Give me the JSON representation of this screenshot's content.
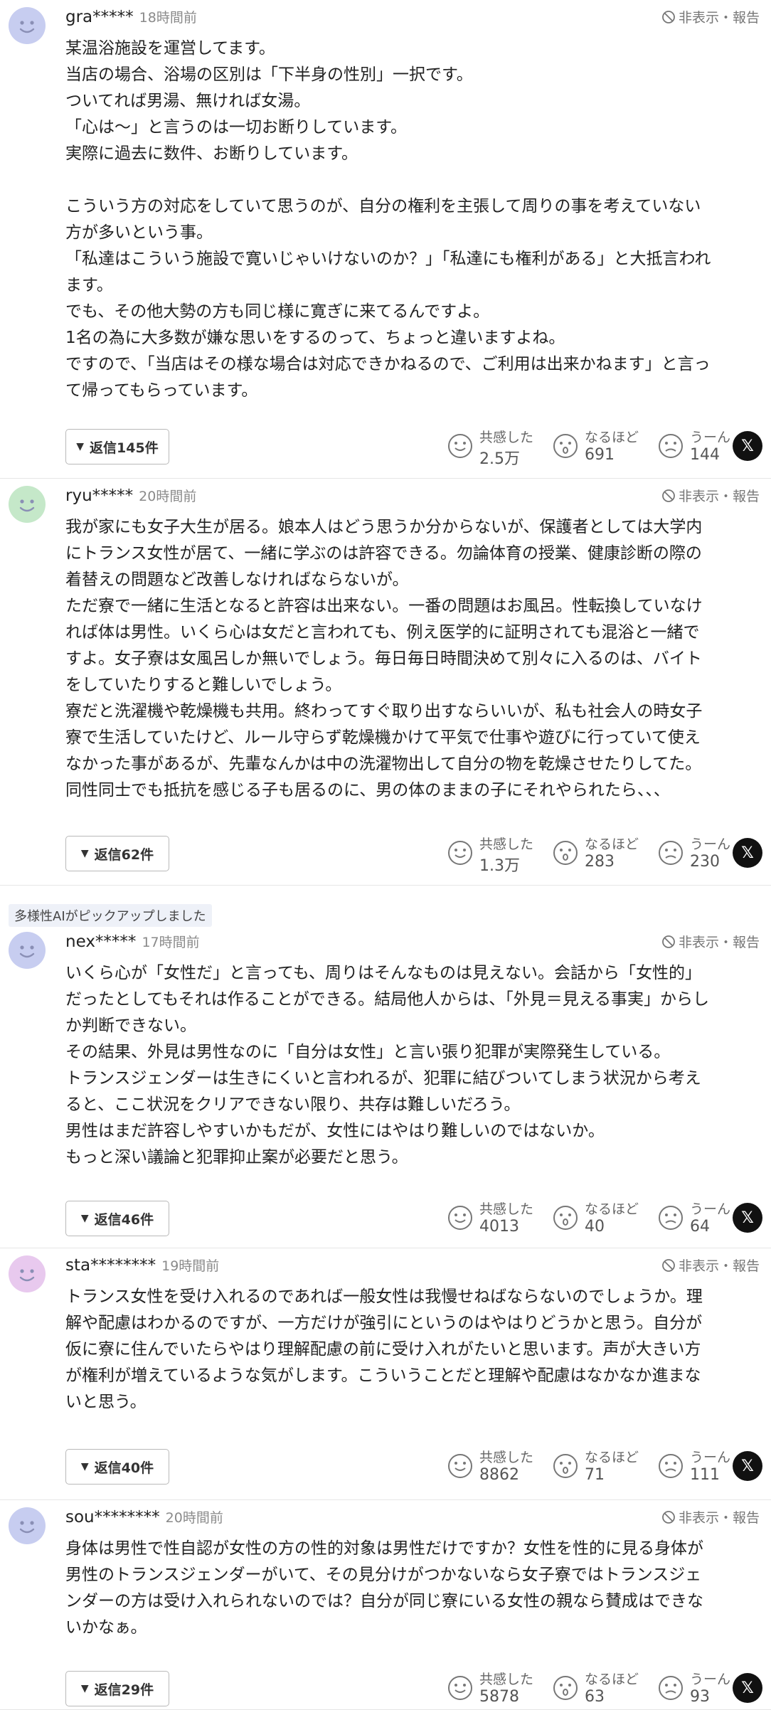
{
  "controls": {
    "hide_report": "非表示・報告",
    "reaction_labels": {
      "empathy": "共感した",
      "naruhodo": "なるほど",
      "uun": "うーん"
    },
    "share_x": "𝕏"
  },
  "pickup_badge": "多様性AIがピックアップしました",
  "comments": [
    {
      "user": "gra*****",
      "time": "18時間前",
      "avatar_color": "#c7cdf0",
      "text": "某温浴施設を運営してます。\n当店の場合、浴場の区別は「下半身の性別」一択です。\nついてれば男湯、無ければ女湯。\n「心は〜」と言うのは一切お断りしています。\n実際に過去に数件、お断りしています。\n\nこういう方の対応をしていて思うのが、自分の権利を主張して周りの事を考えていない\n方が多いという事。\n「私達はこういう施設で寛いじゃいけないのか？」「私達にも権利がある」と大抵言われ\nます。\nでも、その他大勢の方も同じ様に寛ぎに来てるんですよ。\n1名の為に大多数が嫌な思いをするのって、ちょっと違いますよね。\nですので、「当店はその様な場合は対応できかねるので、ご利用は出来かねます」と言っ\nて帰ってもらっています。",
      "reply": "返信145件",
      "empathy": "2.5万",
      "naruhodo": "691",
      "uun": "144"
    },
    {
      "user": "ryu*****",
      "time": "20時間前",
      "avatar_color": "#c5e8c9",
      "text": "我が家にも女子大生が居る。娘本人はどう思うか分からないが、保護者としては大学内\nにトランス女性が居て、一緒に学ぶのは許容できる。勿論体育の授業、健康診断の際の\n着替えの問題など改善しなければならないが。\nただ寮で一緒に生活となると許容は出来ない。一番の問題はお風呂。性転換していなけ\nれば体は男性。いくら心は女だと言われても、例え医学的に証明されても混浴と一緒で\nすよ。女子寮は女風呂しか無いでしょう。毎日毎日時間決めて別々に入るのは、バイト\nをしていたりすると難しいでしょう。\n寮だと洗濯機や乾燥機も共用。終わってすぐ取り出すならいいが、私も社会人の時女子\n寮で生活していたけど、ルール守らず乾燥機かけて平気で仕事や遊びに行っていて使え\nなかった事があるが、先輩なんかは中の洗濯物出して自分の物を乾燥させたりしてた。\n同性同士でも抵抗を感じる子も居るのに、男の体のままの子にそれやられたら、、、",
      "reply": "返信62件",
      "empathy": "1.3万",
      "naruhodo": "283",
      "uun": "230"
    },
    {
      "user": "nex*****",
      "time": "17時間前",
      "avatar_color": "#c7cdf0",
      "text": "いくら心が「女性だ」と言っても、周りはそんなものは見えない。会話から「女性的」\nだったとしてもそれは作ることができる。結局他人からは、「外見＝見える事実」からし\nか判断できない。\nその結果、外見は男性なのに「自分は女性」と言い張り犯罪が実際発生している。\nトランスジェンダーは生きにくいと言われるが、犯罪に結びついてしまう状況から考え\nると、ここ状況をクリアできない限り、共存は難しいだろう。\n男性はまだ許容しやすいかもだが、女性にはやはり難しいのではないか。\nもっと深い議論と犯罪抑止案が必要だと思う。",
      "reply": "返信46件",
      "empathy": "4013",
      "naruhodo": "40",
      "uun": "64"
    },
    {
      "user": "sta********",
      "time": "19時間前",
      "avatar_color": "#e8c9ee",
      "text": "トランス女性を受け入れるのであれば一般女性は我慢せねばならないのでしょうか。理\n解や配慮はわかるのですが、一方だけが強引にというのはやはりどうかと思う。自分が\n仮に寮に住んでいたらやはり理解配慮の前に受け入れがたいと思います。声が大きい方\nが権利が増えているような気がします。こういうことだと理解や配慮はなかなか進まな\nいと思う。",
      "reply": "返信40件",
      "empathy": "8862",
      "naruhodo": "71",
      "uun": "111"
    },
    {
      "user": "sou********",
      "time": "20時間前",
      "avatar_color": "#c7cdf0",
      "text": "身体は男性で性自認が女性の方の性的対象は男性だけですか？女性を性的に見る身体が\n男性のトランスジェンダーがいて、その見分けがつかないなら女子寮ではトランスジェ\nンダーの方は受け入れられないのでは？自分が同じ寮にいる女性の親なら賛成はできな\nいかなぁ。",
      "reply": "返信29件",
      "empathy": "5878",
      "naruhodo": "63",
      "uun": "93"
    }
  ]
}
